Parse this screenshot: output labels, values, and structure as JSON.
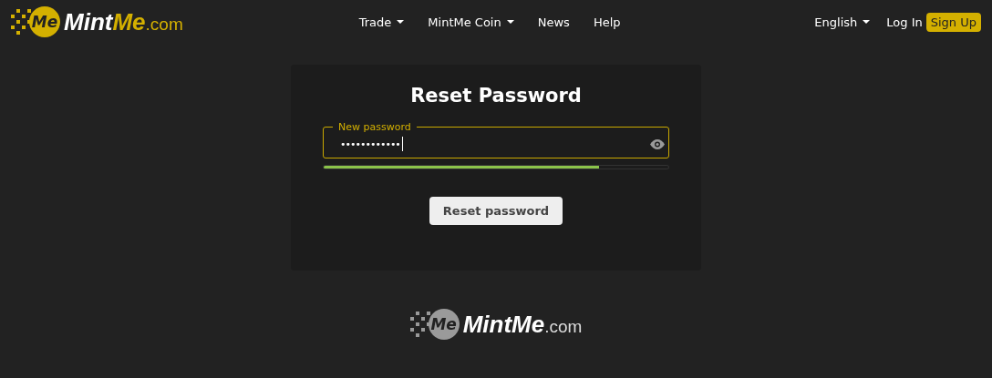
{
  "header": {
    "logo": {
      "badge": "Me",
      "name_parts": [
        "Mint",
        "Me"
      ],
      "suffix": ".com"
    },
    "nav": [
      {
        "label": "Trade",
        "dropdown": true
      },
      {
        "label": "MintMe Coin",
        "dropdown": true
      },
      {
        "label": "News",
        "dropdown": false
      },
      {
        "label": "Help",
        "dropdown": false
      }
    ],
    "language": {
      "label": "English"
    },
    "login": "Log In",
    "signup": "Sign Up"
  },
  "form": {
    "title": "Reset Password",
    "field": {
      "label": "New password",
      "value": "••••••••••••"
    },
    "strength": {
      "level": 0.8
    },
    "button": "Reset password"
  },
  "footer": {
    "logo": {
      "badge": "Me",
      "name_parts": [
        "Mint",
        "Me"
      ],
      "suffix": ".com"
    }
  }
}
